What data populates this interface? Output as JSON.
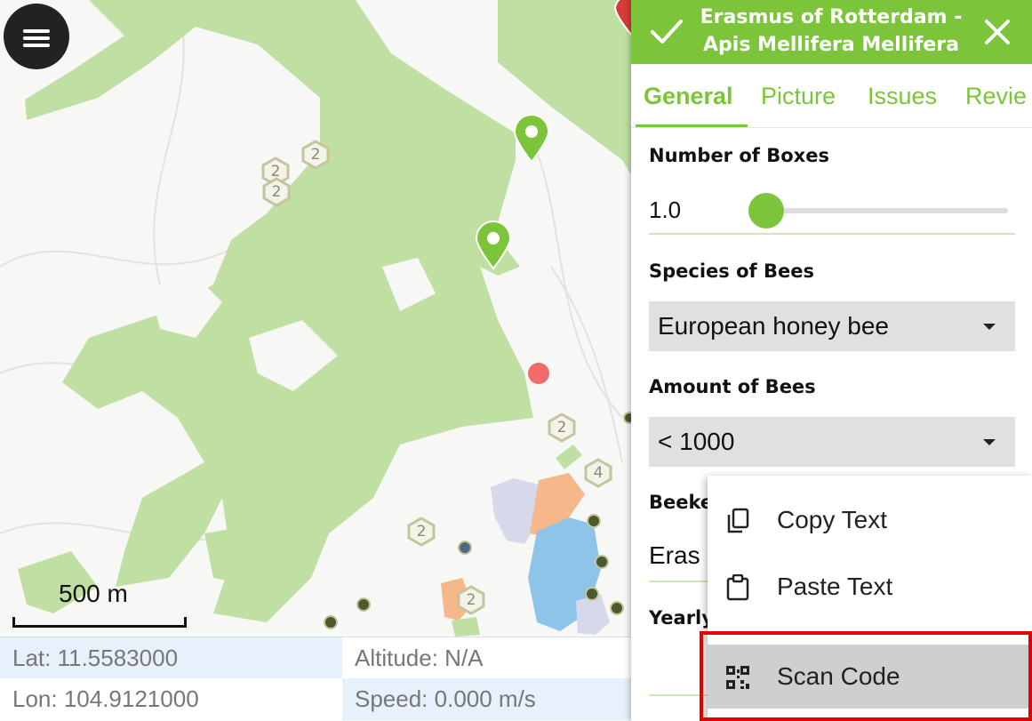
{
  "map": {
    "clusters": [
      {
        "count": "2"
      },
      {
        "count": "2"
      },
      {
        "count": "2"
      },
      {
        "count": "2"
      },
      {
        "count": "4"
      },
      {
        "count": "2"
      },
      {
        "count": "2"
      }
    ],
    "scale_label": "500 m"
  },
  "status": {
    "lat": "Lat: 11.5583000",
    "altitude": "Altitude: N/A",
    "lon": "Lon: 104.9121000",
    "speed": "Speed: 0.000 m/s"
  },
  "panel": {
    "title_line1": "Erasmus of Rotterdam -",
    "title_line2": "Apis Mellifera Mellifera",
    "tabs": [
      {
        "label": "General"
      },
      {
        "label": "Picture"
      },
      {
        "label": "Issues"
      },
      {
        "label": "Revie"
      }
    ],
    "fields": {
      "boxes_label": "Number of Boxes",
      "boxes_value": "1.0",
      "boxes_slider_fraction": 0.0,
      "species_label": "Species of Bees",
      "species_value": "European honey bee",
      "amount_label": "Amount of Bees",
      "amount_value": "< 1000",
      "beekeeper_label": "Beeke",
      "beekeeper_value": "Eras",
      "yearly_label": "Yearly"
    }
  },
  "context_menu": {
    "items": [
      {
        "label": "Copy Text",
        "icon": "copy-icon"
      },
      {
        "label": "Paste Text",
        "icon": "clipboard-icon"
      },
      {
        "label": "Scan Code",
        "icon": "qr-code-icon"
      }
    ]
  },
  "colors": {
    "accent": "#7cc53a",
    "forest": "#bfe0a2",
    "highlight_box": "#e60000"
  }
}
